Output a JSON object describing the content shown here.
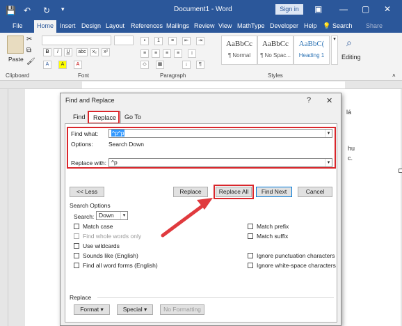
{
  "window": {
    "title": "Document1 - Word",
    "signin": "Sign in",
    "minimize": "—",
    "restore": "▢",
    "close": "✕",
    "ribbon_options": "▣"
  },
  "quick_access": {
    "save": "💾",
    "undo": "↶",
    "redo": "↻",
    "more": "▾"
  },
  "tabs": [
    "File",
    "Home",
    "Insert",
    "Design",
    "Layout",
    "References",
    "Mailings",
    "Review",
    "View",
    "MathType",
    "Developer",
    "Help"
  ],
  "tell_me": "Search",
  "share": "Share",
  "ribbon": {
    "paste": "Paste",
    "clipboard": "Clipboard",
    "font": "Font",
    "paragraph": "Paragraph",
    "styles": "Styles",
    "editing": "Editing",
    "styles_items": [
      {
        "preview": "AaBbCc",
        "label": "¶ Normal"
      },
      {
        "preview": "AaBbCc",
        "label": "¶ No Spac..."
      },
      {
        "preview": "AaBbC(",
        "label": "Heading 1"
      }
    ],
    "font_buttons": [
      "B",
      "I",
      "U",
      "abc",
      "x₂",
      "x²",
      "A",
      "A",
      "A"
    ]
  },
  "doc_side_text": [
    "lá",
    "hu",
    "c."
  ],
  "dialog": {
    "title": "Find and Replace",
    "help": "?",
    "close": "✕",
    "tabs": [
      "Find",
      "Replace",
      "Go To"
    ],
    "find_label": "Find what:",
    "find_value": "^p^p",
    "options_label": "Options:",
    "options_value": "Search Down",
    "replace_label": "Replace with:",
    "replace_value": "^p",
    "less_button": "<< Less",
    "replace_button": "Replace",
    "replace_all_button": "Replace All",
    "find_next_button": "Find Next",
    "cancel_button": "Cancel",
    "search_options": "Search Options",
    "search_label": "Search:",
    "search_value": "Down",
    "left_checks": [
      {
        "label": "Match case",
        "dim": false
      },
      {
        "label": "Find whole words only",
        "dim": true
      },
      {
        "label": "Use wildcards",
        "dim": false
      },
      {
        "label": "Sounds like (English)",
        "dim": false
      },
      {
        "label": "Find all word forms (English)",
        "dim": false
      }
    ],
    "right_checks": [
      {
        "label": "Match prefix"
      },
      {
        "label": "Match suffix"
      },
      {
        "label": "Ignore punctuation characters"
      },
      {
        "label": "Ignore white-space characters"
      }
    ],
    "replace_section": "Replace",
    "format_button": "Format ▾",
    "special_button": "Special ▾",
    "no_formatting_button": "No Formatting"
  },
  "colors": {
    "brand": "#2b579a",
    "highlight_red": "#d9262b",
    "arrow_red": "#e03a3e"
  }
}
